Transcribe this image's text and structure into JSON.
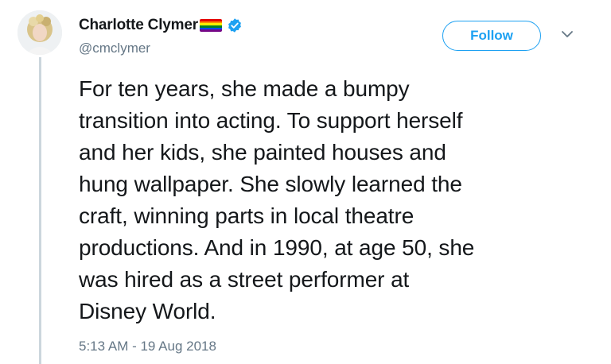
{
  "user": {
    "display_name": "Charlotte Clymer",
    "handle": "@cmclymer",
    "flag_icon": "rainbow-flag-icon",
    "verified_icon": "verified-badge-icon"
  },
  "follow_button": {
    "label": "Follow"
  },
  "menu": {
    "icon": "chevron-down-icon"
  },
  "tweet": {
    "lines": [
      "For ten years, she made a bumpy",
      "transition into acting. To support herself",
      "and her kids, she painted houses and",
      "hung wallpaper. She slowly learned the",
      "craft, winning parts in local theatre",
      "productions. And in 1990, at age 50, she",
      "was hired as a street performer at",
      "Disney World."
    ],
    "timestamp": "5:13 AM - 19 Aug 2018"
  },
  "colors": {
    "accent": "#1da1f2",
    "text": "#14171a",
    "secondary": "#657786",
    "thread_line": "#ccd6dd"
  }
}
